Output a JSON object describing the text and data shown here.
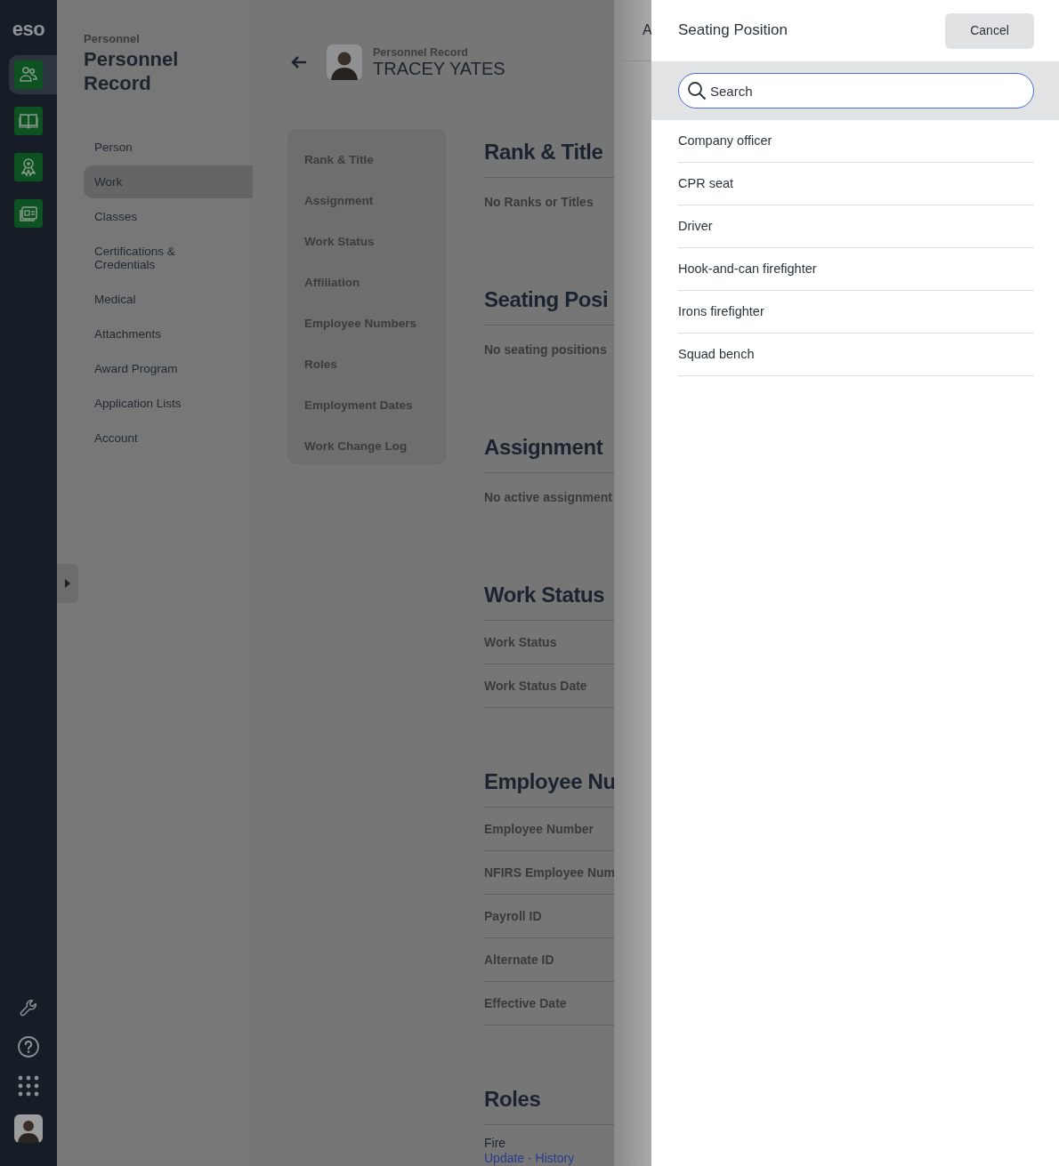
{
  "app_sidebar": {
    "logo": "eso",
    "nav": [
      {
        "selected": true
      },
      {
        "selected": false
      },
      {
        "selected": false
      },
      {
        "selected": false
      }
    ]
  },
  "page_nav": {
    "breadcrumb": "Personnel",
    "title": "Personnel Record",
    "items": [
      {
        "label": "Person",
        "selected": false
      },
      {
        "label": "Work",
        "selected": true
      },
      {
        "label": "Classes",
        "selected": false
      },
      {
        "label": "Certifications & Credentials",
        "selected": false
      },
      {
        "label": "Medical",
        "selected": false
      },
      {
        "label": "Attachments",
        "selected": false
      },
      {
        "label": "Award Program",
        "selected": false
      },
      {
        "label": "Application Lists",
        "selected": false
      },
      {
        "label": "Account",
        "selected": false
      }
    ]
  },
  "record_header": {
    "subtitle": "Personnel Record",
    "name": "TRACEY YATES"
  },
  "section_nav": {
    "items": [
      "Rank & Title",
      "Assignment",
      "Work Status",
      "Affiliation",
      "Employee Numbers",
      "Roles",
      "Employment Dates",
      "Work Change Log"
    ]
  },
  "sections": [
    {
      "title": "Rank & Title",
      "rows": [
        {
          "kind": "note",
          "text": "No Ranks or Titles"
        }
      ]
    },
    {
      "title": "Seating Posi",
      "rows": [
        {
          "kind": "note",
          "text": "No seating positions"
        }
      ]
    },
    {
      "title": "Assignment",
      "rows": [
        {
          "kind": "note",
          "text": "No active assignment"
        }
      ]
    },
    {
      "title": "Work Status",
      "rows": [
        {
          "kind": "field",
          "text": "Work Status"
        },
        {
          "kind": "field",
          "text": "Work Status Date"
        }
      ]
    },
    {
      "title": "Employee Nu",
      "rows": [
        {
          "kind": "field",
          "text": "Employee Number"
        },
        {
          "kind": "field",
          "text": "NFIRS Employee Num"
        },
        {
          "kind": "field",
          "text": "Payroll ID"
        },
        {
          "kind": "field",
          "text": "Alternate ID"
        },
        {
          "kind": "field",
          "text": "Effective Date"
        }
      ]
    },
    {
      "title": "Roles",
      "rows": [
        {
          "kind": "value",
          "text": "Fire"
        },
        {
          "kind": "links",
          "parts": [
            {
              "kind": "link",
              "text": "Update"
            },
            {
              "kind": "sep",
              "text": "-"
            },
            {
              "kind": "link",
              "text": "History"
            }
          ]
        }
      ]
    }
  ],
  "background_panel": {
    "title": "A"
  },
  "drawer": {
    "title": "Seating Position",
    "cancel": "Cancel",
    "search": {
      "placeholder": "Search"
    },
    "options": [
      "Company officer",
      "CPR seat",
      "Driver",
      "Hook-and-can firefighter",
      "Irons firefighter",
      "Squad bench"
    ]
  }
}
